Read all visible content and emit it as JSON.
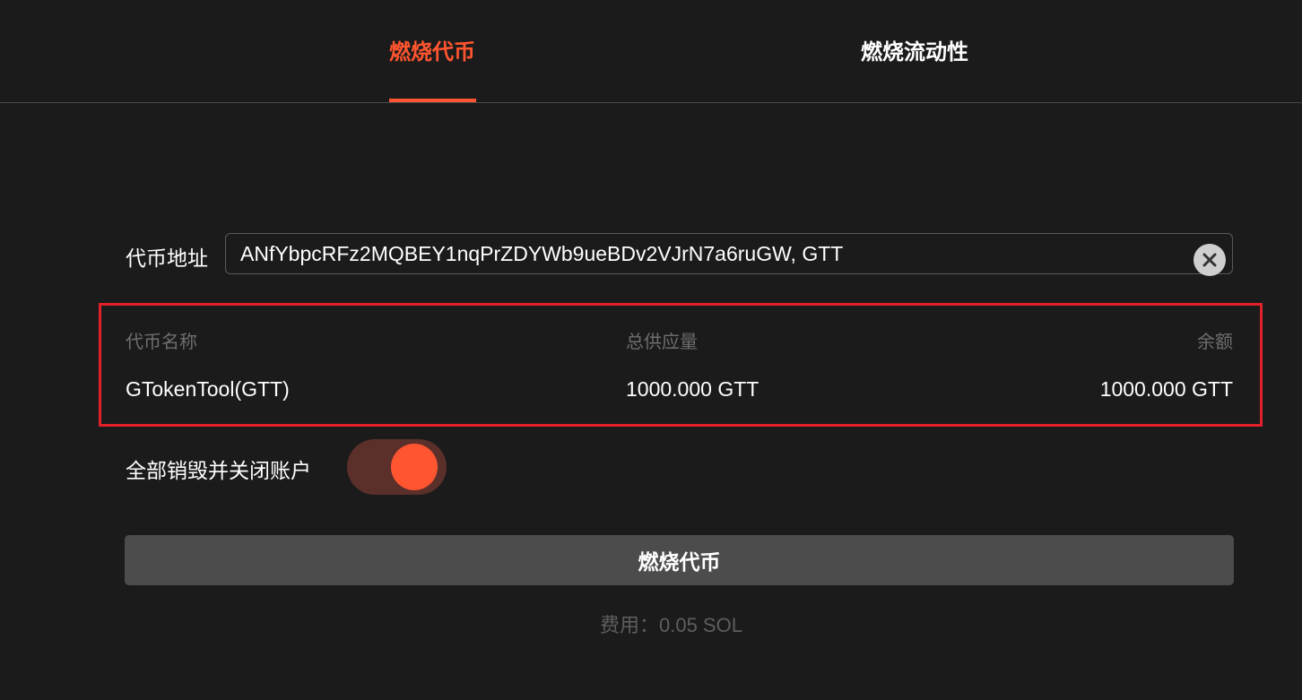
{
  "tabs": {
    "burn_token": "燃烧代币",
    "burn_liquidity": "燃烧流动性",
    "active": "burn_token"
  },
  "form": {
    "address_label": "代币地址",
    "address_value": "ANfYbpcRFz2MQBEY1nqPrZDYWb9ueBDv2VJrN7a6ruGW, GTT"
  },
  "token_info": {
    "headers": {
      "name": "代币名称",
      "supply": "总供应量",
      "balance": "余额"
    },
    "values": {
      "name": "GTokenTool(GTT)",
      "supply": "1000.000 GTT",
      "balance": "1000.000 GTT"
    }
  },
  "toggle": {
    "label": "全部销毁并关闭账户",
    "on": true
  },
  "action": {
    "burn_button": "燃烧代币",
    "fee": "费用：0.05 SOL"
  },
  "colors": {
    "accent": "#ff5530",
    "highlight_border": "#e2202a",
    "background": "#1b1b1b"
  },
  "icons": {
    "clear": "close-circle-icon"
  }
}
